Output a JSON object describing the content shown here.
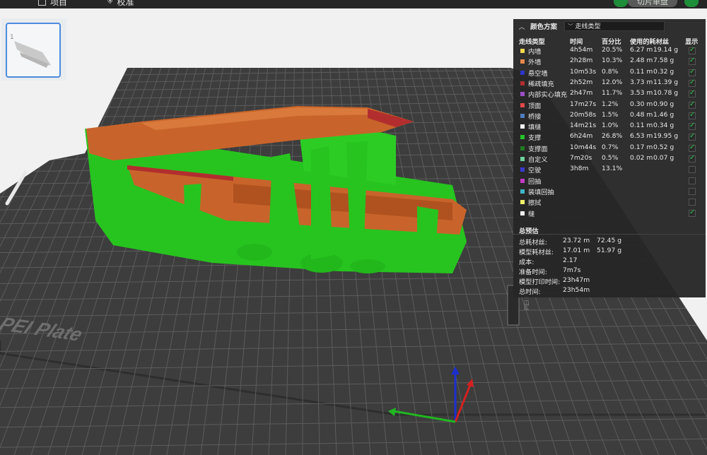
{
  "topbar": {
    "tab_project": "项目",
    "tab_calibrate": "校准",
    "slice_button": "切片单盘"
  },
  "plate": {
    "number": "1",
    "label": "u Textured PEI Plate",
    "side_label": "PEI P"
  },
  "panel": {
    "title": "颜色方案",
    "scheme": "走线类型",
    "headers": {
      "type": "走线类型",
      "time": "时间",
      "percent": "百分比",
      "filament": "使用的耗材丝",
      "show": "显示"
    },
    "rows": [
      {
        "name": "内墙",
        "color": "#f2d94e",
        "time": "4h54m",
        "pct": "20.5%",
        "len": "6.27 m",
        "wt": "19.14 g",
        "on": true
      },
      {
        "name": "外墙",
        "color": "#e8894a",
        "time": "2h28m",
        "pct": "10.3%",
        "len": "2.48 m",
        "wt": "7.58 g",
        "on": true
      },
      {
        "name": "悬空墙",
        "color": "#2b36c7",
        "time": "10m53s",
        "pct": "0.8%",
        "len": "0.11 m",
        "wt": "0.32 g",
        "on": true
      },
      {
        "name": "稀疏填充",
        "color": "#b22e2e",
        "time": "2h52m",
        "pct": "12.0%",
        "len": "3.73 m",
        "wt": "11.39 g",
        "on": true
      },
      {
        "name": "内部实心填充",
        "color": "#9b4fc6",
        "time": "2h47m",
        "pct": "11.7%",
        "len": "3.53 m",
        "wt": "10.78 g",
        "on": true
      },
      {
        "name": "顶面",
        "color": "#e04848",
        "time": "17m27s",
        "pct": "1.2%",
        "len": "0.30 m",
        "wt": "0.90 g",
        "on": true
      },
      {
        "name": "桥接",
        "color": "#4f7dbf",
        "time": "20m58s",
        "pct": "1.5%",
        "len": "0.48 m",
        "wt": "1.46 g",
        "on": true
      },
      {
        "name": "填缝",
        "color": "#f4f4f4",
        "time": "14m21s",
        "pct": "1.0%",
        "len": "0.11 m",
        "wt": "0.34 g",
        "on": true
      },
      {
        "name": "支撑",
        "color": "#25c22c",
        "time": "6h24m",
        "pct": "26.8%",
        "len": "6.53 m",
        "wt": "19.95 g",
        "on": true
      },
      {
        "name": "支撑面",
        "color": "#1f7a22",
        "time": "10m44s",
        "pct": "0.7%",
        "len": "0.17 m",
        "wt": "0.52 g",
        "on": true
      },
      {
        "name": "自定义",
        "color": "#6fd19a",
        "time": "7m20s",
        "pct": "0.5%",
        "len": "0.02 m",
        "wt": "0.07 g",
        "on": true
      },
      {
        "name": "空驶",
        "color": "#3a3ad0",
        "time": "3h8m",
        "pct": "13.1%",
        "len": "",
        "wt": "",
        "on": false
      },
      {
        "name": "回抽",
        "color": "#c23ac7",
        "time": "",
        "pct": "",
        "len": "",
        "wt": "",
        "on": false
      },
      {
        "name": "装填回抽",
        "color": "#3fb7c8",
        "time": "",
        "pct": "",
        "len": "",
        "wt": "",
        "on": false
      },
      {
        "name": "擦拭",
        "color": "#f2f06a",
        "time": "",
        "pct": "",
        "len": "",
        "wt": "",
        "on": false
      },
      {
        "name": "缝",
        "color": "#f0f0f0",
        "time": "",
        "pct": "",
        "len": "",
        "wt": "",
        "on": true
      }
    ],
    "estimate_title": "总预估",
    "estimates": [
      {
        "label": "总耗材丝:",
        "v1": "23.72 m",
        "v2": "72.45 g"
      },
      {
        "label": "模型耗材丝:",
        "v1": "17.01 m",
        "v2": "51.97 g"
      },
      {
        "label": "成本:",
        "v1": "2.17",
        "v2": ""
      },
      {
        "label": "准备时间:",
        "v1": "7m7s",
        "v2": ""
      },
      {
        "label": "模型打印时间:",
        "v1": "23h47m",
        "v2": ""
      },
      {
        "label": "总时间:",
        "v1": "23h54m",
        "v2": ""
      }
    ]
  },
  "colors": {
    "plate": "#3d3d3d",
    "grid": "#5c5c5c",
    "model": "#c8642b",
    "support": "#27c41f",
    "accent": "#2fbf4a"
  },
  "icons": {
    "collapse": "chevron-up-icon",
    "dropdown": "chevron-down-icon",
    "check": "check-icon"
  }
}
